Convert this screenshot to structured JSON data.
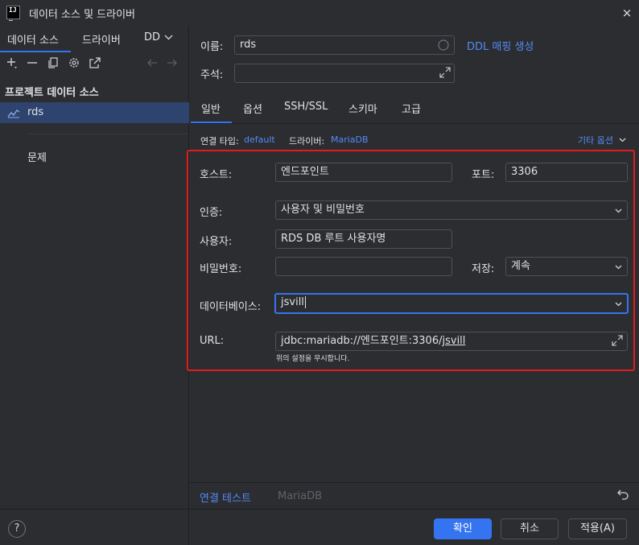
{
  "window": {
    "title": "데이터 소스 및 드라이버",
    "close_icon": "×"
  },
  "sidebar": {
    "tabs": [
      "데이터 소스",
      "드라이버",
      "DD"
    ],
    "section_title": "프로젝트 데이터 소스",
    "selected_item": "rds",
    "issues_label": "문제"
  },
  "header": {
    "name_label": "이름:",
    "name_value": "rds",
    "ddl_link": "DDL 매핑 생성",
    "comment_label": "주석:",
    "comment_value": ""
  },
  "tabs": [
    "일반",
    "옵션",
    "SSH/SSL",
    "스키마",
    "고급"
  ],
  "connection": {
    "type_label": "연결 타입:",
    "type_value": "default",
    "driver_label": "드라이버:",
    "driver_value": "MariaDB",
    "more_options": "기타 옵션"
  },
  "form": {
    "host_label": "호스트:",
    "host_value": "엔드포인트",
    "port_label": "포트:",
    "port_value": "3306",
    "auth_label": "인증:",
    "auth_value": "사용자 및 비밀번호",
    "user_label": "사용자:",
    "user_value": "RDS DB 루트 사용자명",
    "password_label": "비밀번호:",
    "password_value": "",
    "save_label": "저장:",
    "save_value": "계속",
    "database_label": "데이터베이스:",
    "database_value": "jsvill",
    "url_label": "URL:",
    "url_prefix": "jdbc:mariadb://엔드포인트:3306/",
    "url_db": "jsvill",
    "url_hint": "위의 설정을 무시합니다."
  },
  "footer": {
    "test_link": "연결 테스트",
    "driver_name": "MariaDB",
    "ok": "확인",
    "cancel": "취소",
    "apply": "적용(A)",
    "help": "?"
  },
  "colors": {
    "accent": "#3574f0",
    "link": "#548af7",
    "highlight": "#e01d1d",
    "selection": "#2e436e"
  }
}
